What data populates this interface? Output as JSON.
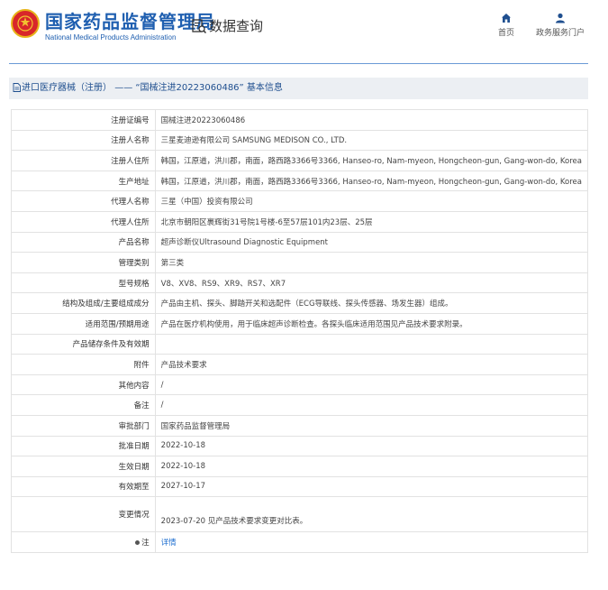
{
  "header": {
    "site_title": "国家药品监督管理局",
    "site_subtitle": "National Medical Products Administration",
    "query_label": "数据查询",
    "nav": [
      {
        "label": "首页",
        "icon": "home-icon"
      },
      {
        "label": "政务服务门户",
        "icon": "user-icon"
      }
    ]
  },
  "breadcrumb": {
    "prefix": "进口医疗器械（注册）",
    "separator": "——",
    "record": "“国械注进20223060486”",
    "suffix": "基本信息"
  },
  "rows": [
    {
      "key": "注册证编号",
      "value": "国械注进20223060486"
    },
    {
      "key": "注册人名称",
      "value": "三星麦迪逊有限公司 SAMSUNG MEDISON CO., LTD."
    },
    {
      "key": "注册人住所",
      "value": "韩国，江原道，洪川郡，南面，路西路3366号3366, Hanseo-ro, Nam-myeon, Hongcheon-gun, Gang-won-do, Korea"
    },
    {
      "key": "生产地址",
      "value": "韩国，江原道，洪川郡，南面，路西路3366号3366, Hanseo-ro, Nam-myeon, Hongcheon-gun, Gang-won-do, Korea"
    },
    {
      "key": "代理人名称",
      "value": "三星（中国）投资有限公司"
    },
    {
      "key": "代理人住所",
      "value": "北京市朝阳区裹辉街31号院1号楼-6至57层101内23层、25层"
    },
    {
      "key": "产品名称",
      "value": "超声诊断仪Ultrasound Diagnostic Equipment"
    },
    {
      "key": "管理类别",
      "value": "第三类"
    },
    {
      "key": "型号规格",
      "value": "V8、XV8、RS9、XR9、RS7、XR7"
    },
    {
      "key": "结构及组成/主要组成成分",
      "value": "产品由主机、探头、脚踏开关和选配件（ECG导联线、探头传感器、场发生器）组成。"
    },
    {
      "key": "适用范围/预期用途",
      "value": "产品在医疗机构使用，用于临床超声诊断检查。各探头临床适用范围见产品技术要求附录。"
    },
    {
      "key": "产品储存条件及有效期",
      "value": ""
    },
    {
      "key": "附件",
      "value": "产品技术要求"
    },
    {
      "key": "其他内容",
      "value": "/"
    },
    {
      "key": "备注",
      "value": "/"
    },
    {
      "key": "审批部门",
      "value": "国家药品监督管理局"
    },
    {
      "key": "批准日期",
      "value": "2022-10-18"
    },
    {
      "key": "生效日期",
      "value": "2022-10-18"
    },
    {
      "key": "有效期至",
      "value": "2027-10-17"
    },
    {
      "key": "变更情况",
      "value": "2023-07-20 见产品技术要求变更对比表。"
    }
  ],
  "note": {
    "key": "注",
    "link": "详情"
  },
  "colors": {
    "brand_blue": "#1f5fb0",
    "link_blue": "#1f6fd0",
    "emblem_red": "#d8262a",
    "crumb_bg": "#eceff3"
  }
}
